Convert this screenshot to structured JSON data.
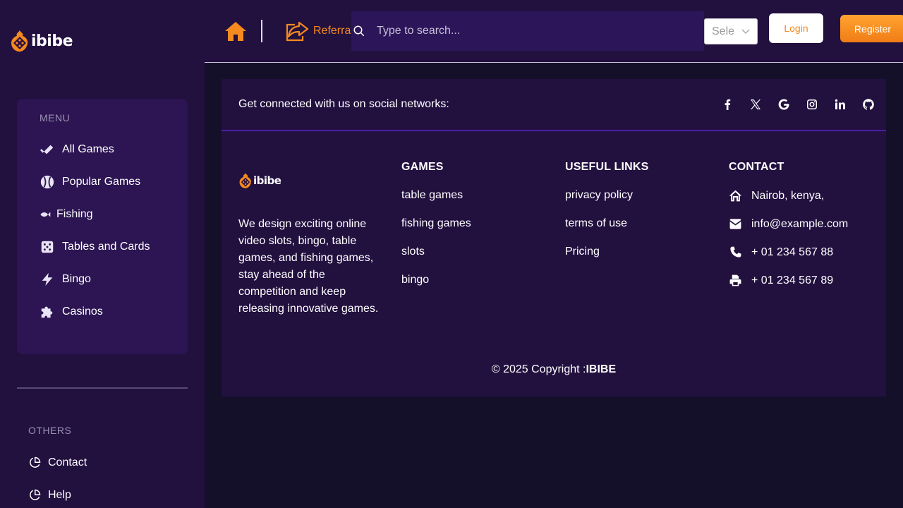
{
  "brand": {
    "name": "ibibe",
    "accent": "#f58a1f"
  },
  "sidebar": {
    "menu_heading": "MENU",
    "items": [
      {
        "label": "All Games",
        "icon": "double-check-icon"
      },
      {
        "label": "Popular Games",
        "icon": "baseball-icon"
      },
      {
        "label": "Fishing",
        "icon": "fish-icon"
      },
      {
        "label": "Tables and Cards",
        "icon": "dice-icon"
      },
      {
        "label": "Bingo",
        "icon": "bolt-icon"
      },
      {
        "label": "Casinos",
        "icon": "puzzle-icon"
      }
    ],
    "others_heading": "OTHERS",
    "others": [
      {
        "label": "Contact",
        "icon": "pie-chart-icon"
      },
      {
        "label": "Help",
        "icon": "pie-chart-icon"
      }
    ]
  },
  "header": {
    "referral_label": "Referral",
    "search_placeholder": "Type to search...",
    "language_select_value": "Sele",
    "login_label": "Login",
    "register_label": "Register"
  },
  "footer": {
    "social_text": "Get connected with us on social networks:",
    "social_icons": [
      "facebook-icon",
      "x-icon",
      "google-icon",
      "instagram-icon",
      "linkedin-icon",
      "github-icon"
    ],
    "about_text": "We design exciting online video slots, bingo, table games, and fishing games, stay ahead of the competition and keep releasing innovative games.",
    "games_heading": "GAMES",
    "games_links": [
      "table games",
      "fishing games",
      "slots",
      "bingo"
    ],
    "useful_heading": "USEFUL LINKS",
    "useful_links": [
      "privacy policy",
      "terms of use",
      "Pricing"
    ],
    "contact_heading": "CONTACT",
    "contact": {
      "address": "Nairob, kenya,",
      "email": "info@example.com",
      "phone": "+ 01 234 567 88",
      "fax": "+ 01 234 567 89"
    },
    "copyright_prefix": "© 2025 Copyright :",
    "copyright_brand": "IBIBE"
  }
}
